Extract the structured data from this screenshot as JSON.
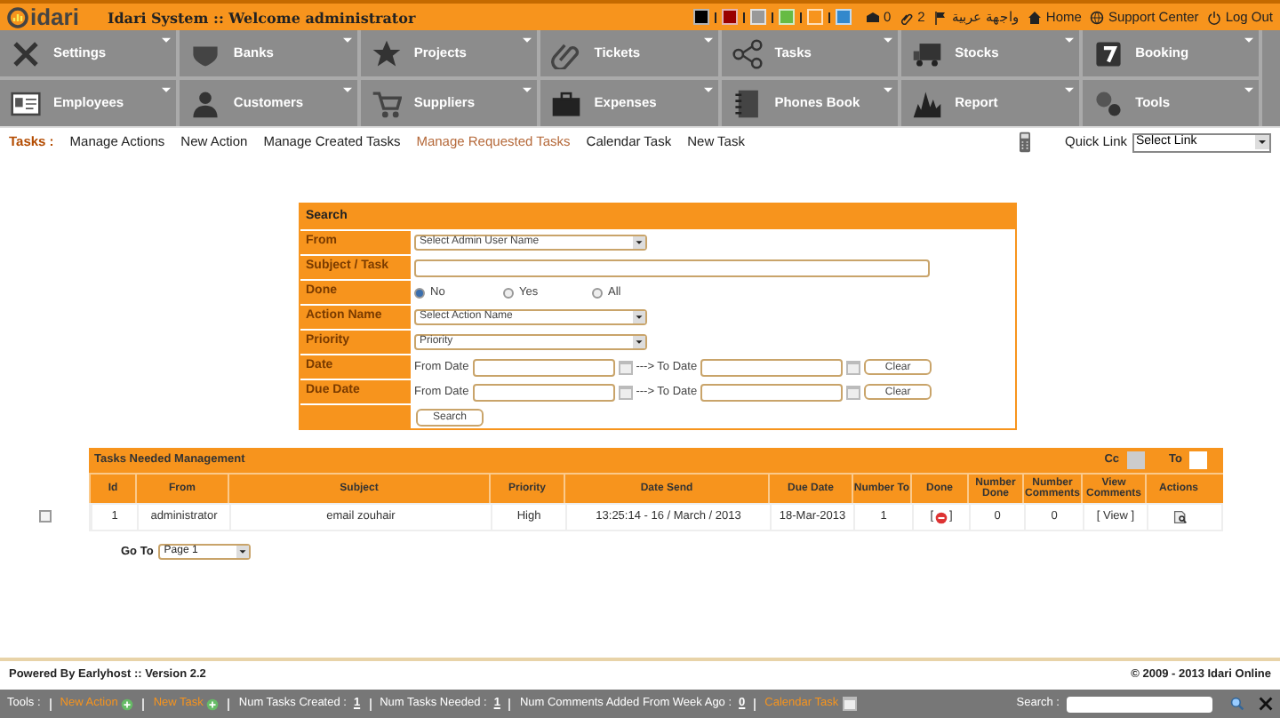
{
  "header": {
    "logo": "idari",
    "title": "Idari System :: Welcome administrator",
    "theme_swatches": [
      {
        "color": "#000000"
      },
      {
        "color": "#990000"
      },
      {
        "color": "#999999"
      },
      {
        "color": "#66bb44"
      },
      {
        "color": "#f7941d"
      },
      {
        "color": "#3388cc"
      }
    ],
    "links": [
      {
        "kind": "mail",
        "label": "0"
      },
      {
        "kind": "clip",
        "label": "2"
      },
      {
        "kind": "flag",
        "label": "واجهة عربية"
      },
      {
        "kind": "home",
        "label": "Home"
      },
      {
        "kind": "globe",
        "label": "Support Center"
      },
      {
        "kind": "power",
        "label": "Log Out"
      }
    ]
  },
  "menu": [
    {
      "kind": "tools",
      "label": "Settings"
    },
    {
      "kind": "shield",
      "label": "Banks"
    },
    {
      "kind": "star",
      "label": "Projects"
    },
    {
      "kind": "clip",
      "label": "Tickets"
    },
    {
      "kind": "share",
      "label": "Tasks"
    },
    {
      "kind": "truck",
      "label": "Stocks"
    },
    {
      "kind": "calendar",
      "label": "Booking"
    },
    {
      "kind": "card",
      "label": "Employees"
    },
    {
      "kind": "person",
      "label": "Customers"
    },
    {
      "kind": "cart",
      "label": "Suppliers"
    },
    {
      "kind": "briefcase",
      "label": "Expenses"
    },
    {
      "kind": "book",
      "label": "Phones Book"
    },
    {
      "kind": "chart",
      "label": "Report"
    },
    {
      "kind": "gears",
      "label": "Tools"
    }
  ],
  "subnav": {
    "label": "Tasks :",
    "items": [
      {
        "label": "Manage Actions",
        "selected": false
      },
      {
        "label": "New Action",
        "selected": false
      },
      {
        "label": "Manage Created Tasks",
        "selected": false
      },
      {
        "label": "Manage Requested Tasks",
        "selected": true
      },
      {
        "label": "Calendar Task",
        "selected": false
      },
      {
        "label": "New Task",
        "selected": false
      }
    ],
    "quick_link_label": "Quick Link",
    "quick_link_value": "Select Link"
  },
  "search": {
    "title": "Search",
    "rows": [
      {
        "kind": "select",
        "label": "From",
        "value": "Select Admin User Name"
      },
      {
        "kind": "text",
        "label": "Subject / Task"
      },
      {
        "kind": "radio",
        "label": "Done",
        "options": [
          {
            "label": "No",
            "selected": true
          },
          {
            "label": "Yes",
            "selected": false
          },
          {
            "label": "All",
            "selected": false
          }
        ]
      },
      {
        "kind": "select",
        "label": "Action Name",
        "value": "Select Action Name"
      },
      {
        "kind": "select",
        "label": "Priority",
        "value": "Priority"
      },
      {
        "kind": "daterange",
        "label": "Date",
        "from": "From Date",
        "arrow": "---> To Date",
        "clear": "Clear"
      },
      {
        "kind": "daterange",
        "label": "Due Date",
        "from": "From Date",
        "arrow": "---> To Date",
        "clear": "Clear"
      },
      {
        "kind": "button",
        "label": "Search"
      }
    ]
  },
  "table": {
    "title": "Tasks Needed Management",
    "cc_label": "Cc",
    "to_label": "To",
    "columns": [
      "Id",
      "From",
      "Subject",
      "Priority",
      "Date Send",
      "Due Date",
      "Number To",
      "Done",
      "Number Done",
      "Number Comments",
      "View Comments",
      "Actions"
    ],
    "rows": [
      {
        "checked": false,
        "done_brackets": [
          "[",
          "]"
        ],
        "cells": [
          "1",
          "administrator",
          "email zouhair",
          "High",
          "13:25:14 - 16 / March / 2013",
          "18-Mar-2013",
          "1",
          "",
          "0",
          "0",
          "[ View ]"
        ]
      }
    ]
  },
  "pager": {
    "label": "Go To",
    "value": "Page 1"
  },
  "footer": {
    "left": "Powered By Earlyhost :: Version 2.2",
    "right": "© 2009 - 2013 Idari Online"
  },
  "bottom_bar": {
    "label": "Tools :",
    "links": [
      "New Action",
      "New Task"
    ],
    "stats": [
      {
        "label": "Num Tasks Created :",
        "value": "1"
      },
      {
        "label": "Num Tasks Needed :",
        "value": "1"
      },
      {
        "label": "Num Comments Added From Week Ago :",
        "value": "0"
      }
    ],
    "calendar_link": "Calendar Task",
    "search_label": "Search :"
  }
}
